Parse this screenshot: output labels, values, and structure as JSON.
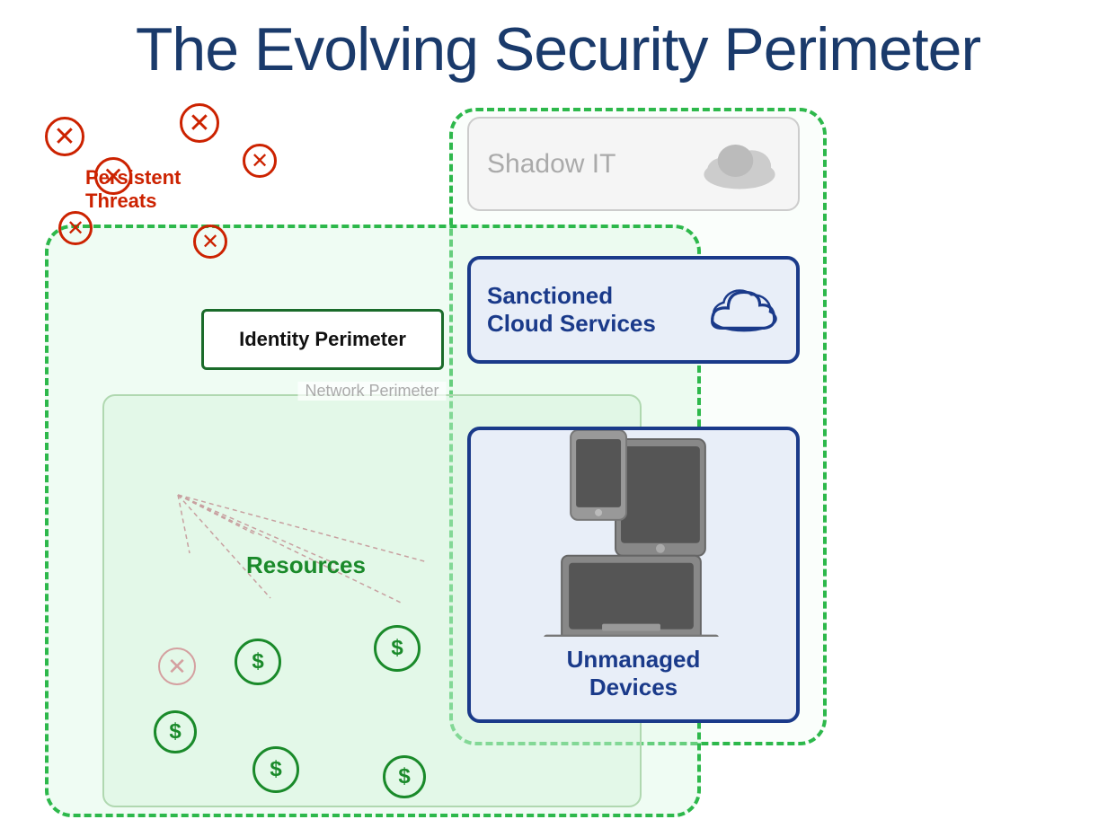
{
  "title": "The Evolving Security Perimeter",
  "labels": {
    "identity_perimeter": "Identity Perimeter",
    "network_perimeter": "Network Perimeter",
    "shadow_it": "Shadow IT",
    "sanctioned_cloud": "Sanctioned\nCloud Services",
    "sanctioned_cloud_line1": "Sanctioned",
    "sanctioned_cloud_line2": "Cloud Services",
    "unmanaged_devices_line1": "Unmanaged",
    "unmanaged_devices_line2": "Devices",
    "persistent_threats_line1": "Persistent",
    "persistent_threats_line2": "Threats",
    "resources": "Resources"
  },
  "colors": {
    "title": "#1a3a6b",
    "threat_red": "#cc2200",
    "green_dark": "#1a8a2a",
    "blue_dark": "#1a3a8a",
    "green_border": "#2db84b",
    "shadow_gray": "#aaa",
    "network_gray": "#b0d8b0"
  }
}
